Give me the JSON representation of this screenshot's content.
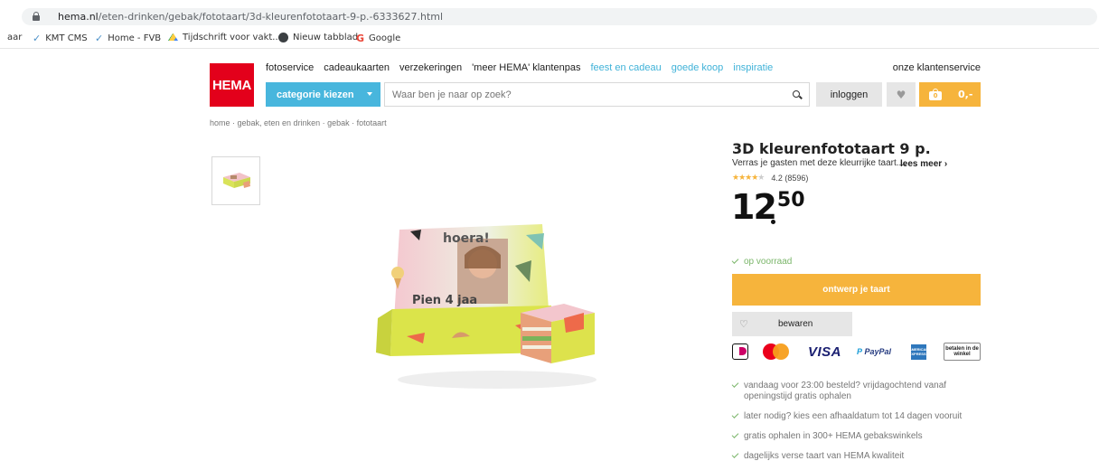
{
  "browser": {
    "url_host": "hema.nl",
    "url_path": "/eten-drinken/gebak/fototaart/3d-kleurenfototaart-9-p.-6333627.html"
  },
  "bookmarks": [
    {
      "label": "aar"
    },
    {
      "label": "KMT CMS",
      "icon": "check-icon"
    },
    {
      "label": "Home - FVB",
      "icon": "check-icon"
    },
    {
      "label": "Tijdschrift voor vakt...",
      "icon": "drive-icon"
    },
    {
      "label": "Nieuw tabblad",
      "icon": "globe-icon"
    },
    {
      "label": "Google",
      "icon": "google-icon"
    }
  ],
  "header": {
    "logo": "HEMA",
    "nav": [
      {
        "label": "fotoservice",
        "color": "#222222"
      },
      {
        "label": "cadeaukaarten",
        "color": "#222222"
      },
      {
        "label": "verzekeringen",
        "color": "#222222"
      },
      {
        "label": "'meer HEMA' klantenpas",
        "color": "#222222"
      },
      {
        "label": "feest en cadeau",
        "color": "#3fb2d8"
      },
      {
        "label": "goede koop",
        "color": "#3fb2d8"
      },
      {
        "label": "inspiratie",
        "color": "#3fb2d8"
      }
    ],
    "service": "onze klantenservice",
    "category_button": "categorie kiezen",
    "search_placeholder": "Waar ben je naar op zoek?",
    "login": "inloggen",
    "cart_count": "0",
    "cart_total": "0,-"
  },
  "breadcrumb": "home · gebak, eten en drinken · gebak · fototaart",
  "product": {
    "title": "3D kleurenfototaart 9 p.",
    "subtitle": "Verras je gasten met deze kleurrijke taart....",
    "read_more": "lees meer ›",
    "rating_value": 4.2,
    "rating_text": "4.2 (8596)",
    "price_euros": "12",
    "price_cents": "50",
    "stock": "op voorraad",
    "cta": "ontwerp je taart",
    "save": "bewaren",
    "cake_text_top": "hoera!",
    "cake_text_side": "Pien 4 jaa"
  },
  "payments": {
    "visa": "VISA",
    "paypal_p": "P",
    "paypal": "PayPal",
    "amex": "AMERICAN EXPRESS",
    "winkel": "betalen in de winkel"
  },
  "usps": [
    "vandaag voor 23:00 besteld? vrijdagochtend vanaf openingstijd gratis ophalen",
    "later nodig? kies een afhaaldatum tot 14 dagen vooruit",
    "gratis ophalen in 300+ HEMA gebakswinkels",
    "dagelijks verse taart van HEMA kwaliteit"
  ],
  "colors": {
    "brand_red": "#e3001b",
    "accent_blue": "#48b6dd",
    "accent_orange": "#f6b43c",
    "stock_green": "#7bb66a"
  }
}
